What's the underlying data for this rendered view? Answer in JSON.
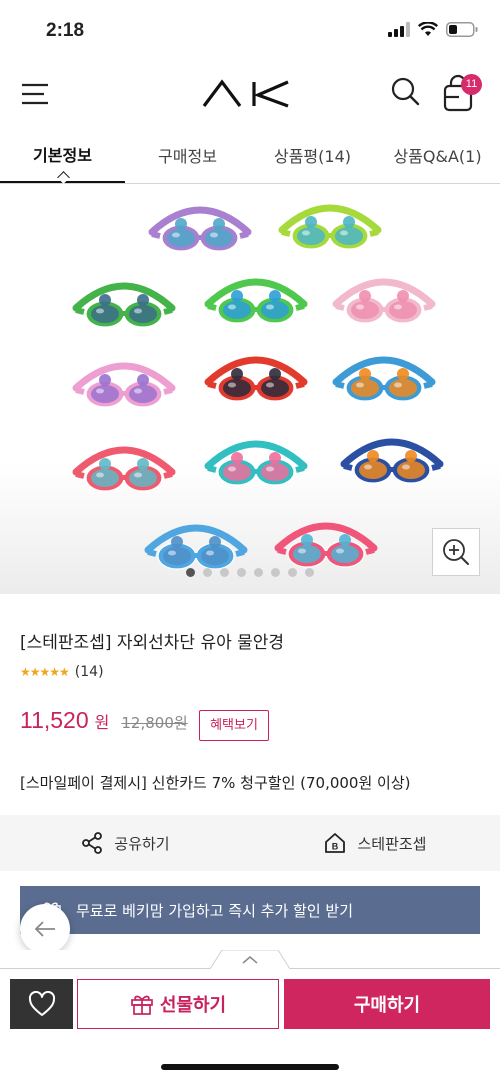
{
  "status_bar": {
    "time": "2:18"
  },
  "header": {
    "logo_text": "AK",
    "cart_count": "11"
  },
  "tabs": [
    {
      "label": "기본정보",
      "active": true
    },
    {
      "label": "구매정보",
      "active": false
    },
    {
      "label": "상품평(14)",
      "active": false
    },
    {
      "label": "상품Q&A(1)",
      "active": false
    }
  ],
  "gallery": {
    "total_slides": 8,
    "active_slide": 1
  },
  "product": {
    "title": "[스테판조셉] 자외선차단 유아 물안경",
    "rating_stars": "★★★★★",
    "rating_count": "(14)",
    "price": "11,520",
    "price_unit": "원",
    "original_price": "12,800원",
    "benefit_label": "혜택보기",
    "promo": "[스마일페이 결제시] 신한카드 7% 청구할인 (70,000원 이상)"
  },
  "actions": {
    "share_label": "공유하기",
    "brand_label": "스테판조셉"
  },
  "banner": {
    "text": "무료로 베키맘 가입하고 즉시 추가 할인 받기"
  },
  "bottom_bar": {
    "gift_label": "선물하기",
    "buy_label": "구매하기"
  },
  "colors": {
    "accent": "#d0265f",
    "banner_bg": "#5a6d90",
    "dark_button": "#333333",
    "star": "#f0a61e"
  }
}
